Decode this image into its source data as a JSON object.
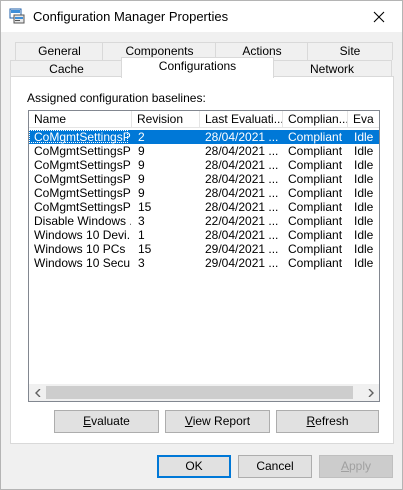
{
  "window": {
    "title": "Configuration Manager Properties"
  },
  "tabs_top": [
    "General",
    "Components",
    "Actions",
    "Site"
  ],
  "tabs_bottom": [
    "Cache",
    "Configurations",
    "Network"
  ],
  "active_tab": "Configurations",
  "panel": {
    "label": "Assigned configuration baselines:",
    "columns": [
      "Name",
      "Revision",
      "Last Evaluati...",
      "Complian...",
      "Eva"
    ],
    "rows": [
      [
        "CoMgmtSettingsPil...",
        "2",
        "28/04/2021 ...",
        "Compliant",
        "Idle"
      ],
      [
        "CoMgmtSettingsPil...",
        "9",
        "28/04/2021 ...",
        "Compliant",
        "Idle"
      ],
      [
        "CoMgmtSettingsPil...",
        "9",
        "28/04/2021 ...",
        "Compliant",
        "Idle"
      ],
      [
        "CoMgmtSettingsPil...",
        "9",
        "28/04/2021 ...",
        "Compliant",
        "Idle"
      ],
      [
        "CoMgmtSettingsPil...",
        "9",
        "28/04/2021 ...",
        "Compliant",
        "Idle"
      ],
      [
        "CoMgmtSettingsPr...",
        "15",
        "28/04/2021 ...",
        "Compliant",
        "Idle"
      ],
      [
        "Disable Windows ...",
        "3",
        "22/04/2021 ...",
        "Compliant",
        "Idle"
      ],
      [
        "Windows 10 Devi...",
        "1",
        "28/04/2021 ...",
        "Compliant",
        "Idle"
      ],
      [
        "Windows 10 PCs",
        "15",
        "29/04/2021 ...",
        "Compliant",
        "Idle"
      ],
      [
        "Windows 10 Secu...",
        "3",
        "29/04/2021 ...",
        "Compliant",
        "Idle"
      ]
    ],
    "selected_row": 0,
    "buttons": {
      "evaluate": {
        "pre": "",
        "u": "E",
        "post": "valuate"
      },
      "view_report": {
        "pre": "",
        "u": "V",
        "post": "iew Report"
      },
      "refresh": {
        "pre": "",
        "u": "R",
        "post": "efresh"
      }
    }
  },
  "footer": {
    "ok": "OK",
    "cancel": "Cancel",
    "apply": {
      "pre": "",
      "u": "A",
      "post": "pply"
    }
  },
  "colors": {
    "selection": "#0078d7",
    "window_bg": "#f0f0f0"
  }
}
